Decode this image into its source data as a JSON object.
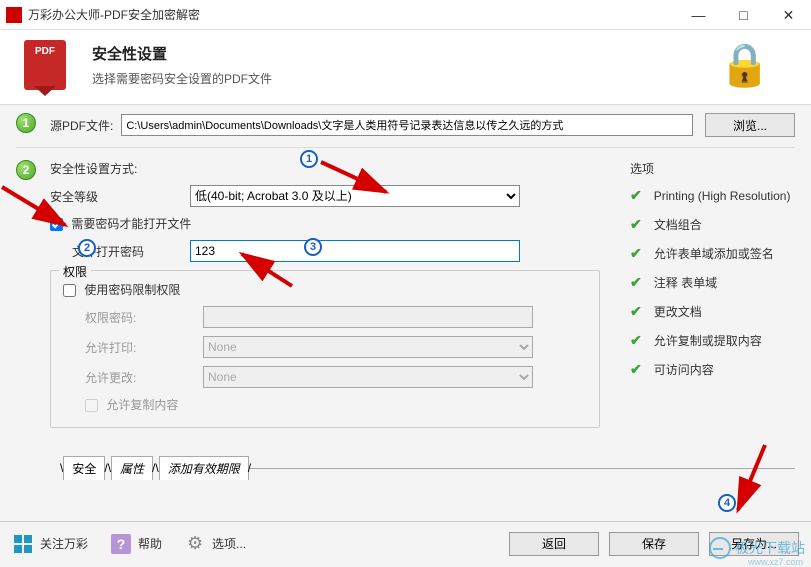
{
  "window": {
    "title": "万彩办公大师-PDF安全加密解密",
    "minimize": "—",
    "maximize": "□",
    "close": "✕"
  },
  "header": {
    "pdf_badge": "PDF",
    "title": "安全性设置",
    "subtitle": "选择需要密码安全设置的PDF文件"
  },
  "step1": {
    "label": "源PDF文件:",
    "path": "C:\\Users\\admin\\Documents\\Downloads\\文字是人类用符号记录表达信息以传之久远的方式",
    "browse": "浏览..."
  },
  "step2": {
    "section": "安全性设置方式:",
    "level_label": "安全等级",
    "level_value": "低(40-bit; Acrobat 3.0 及以上)",
    "need_pwd_checkbox": "需要密码才能打开文件",
    "open_pwd_label": "文件打开密码",
    "open_pwd_value": "123",
    "perm_group": "权限",
    "restrict_perm_checkbox": "使用密码限制权限",
    "perm_pwd_label": "权限密码:",
    "allow_print_label": "允许打印:",
    "allow_print_value": "None",
    "allow_change_label": "允许更改:",
    "allow_change_value": "None",
    "allow_copy_checkbox": "允许复制内容"
  },
  "options": {
    "title": "选项",
    "items": [
      "Printing (High Resolution)",
      "文档组合",
      "允许表单域添加或签名",
      "注释 表单域",
      "更改文档",
      "允许复制或提取内容",
      "可访问内容"
    ]
  },
  "tabs": {
    "t1": "安全",
    "t2": "属性",
    "t3": "添加有效期限",
    "trail": "/"
  },
  "footer": {
    "about": "关注万彩",
    "help": "帮助",
    "options": "选项...",
    "back": "返回",
    "save": "保存",
    "saveas": "另存为..."
  },
  "annot": {
    "b1": "1",
    "b2": "2",
    "b3": "3",
    "b4": "4"
  },
  "watermark": {
    "main": "极光下载站",
    "sub": "www.xz7.com"
  }
}
